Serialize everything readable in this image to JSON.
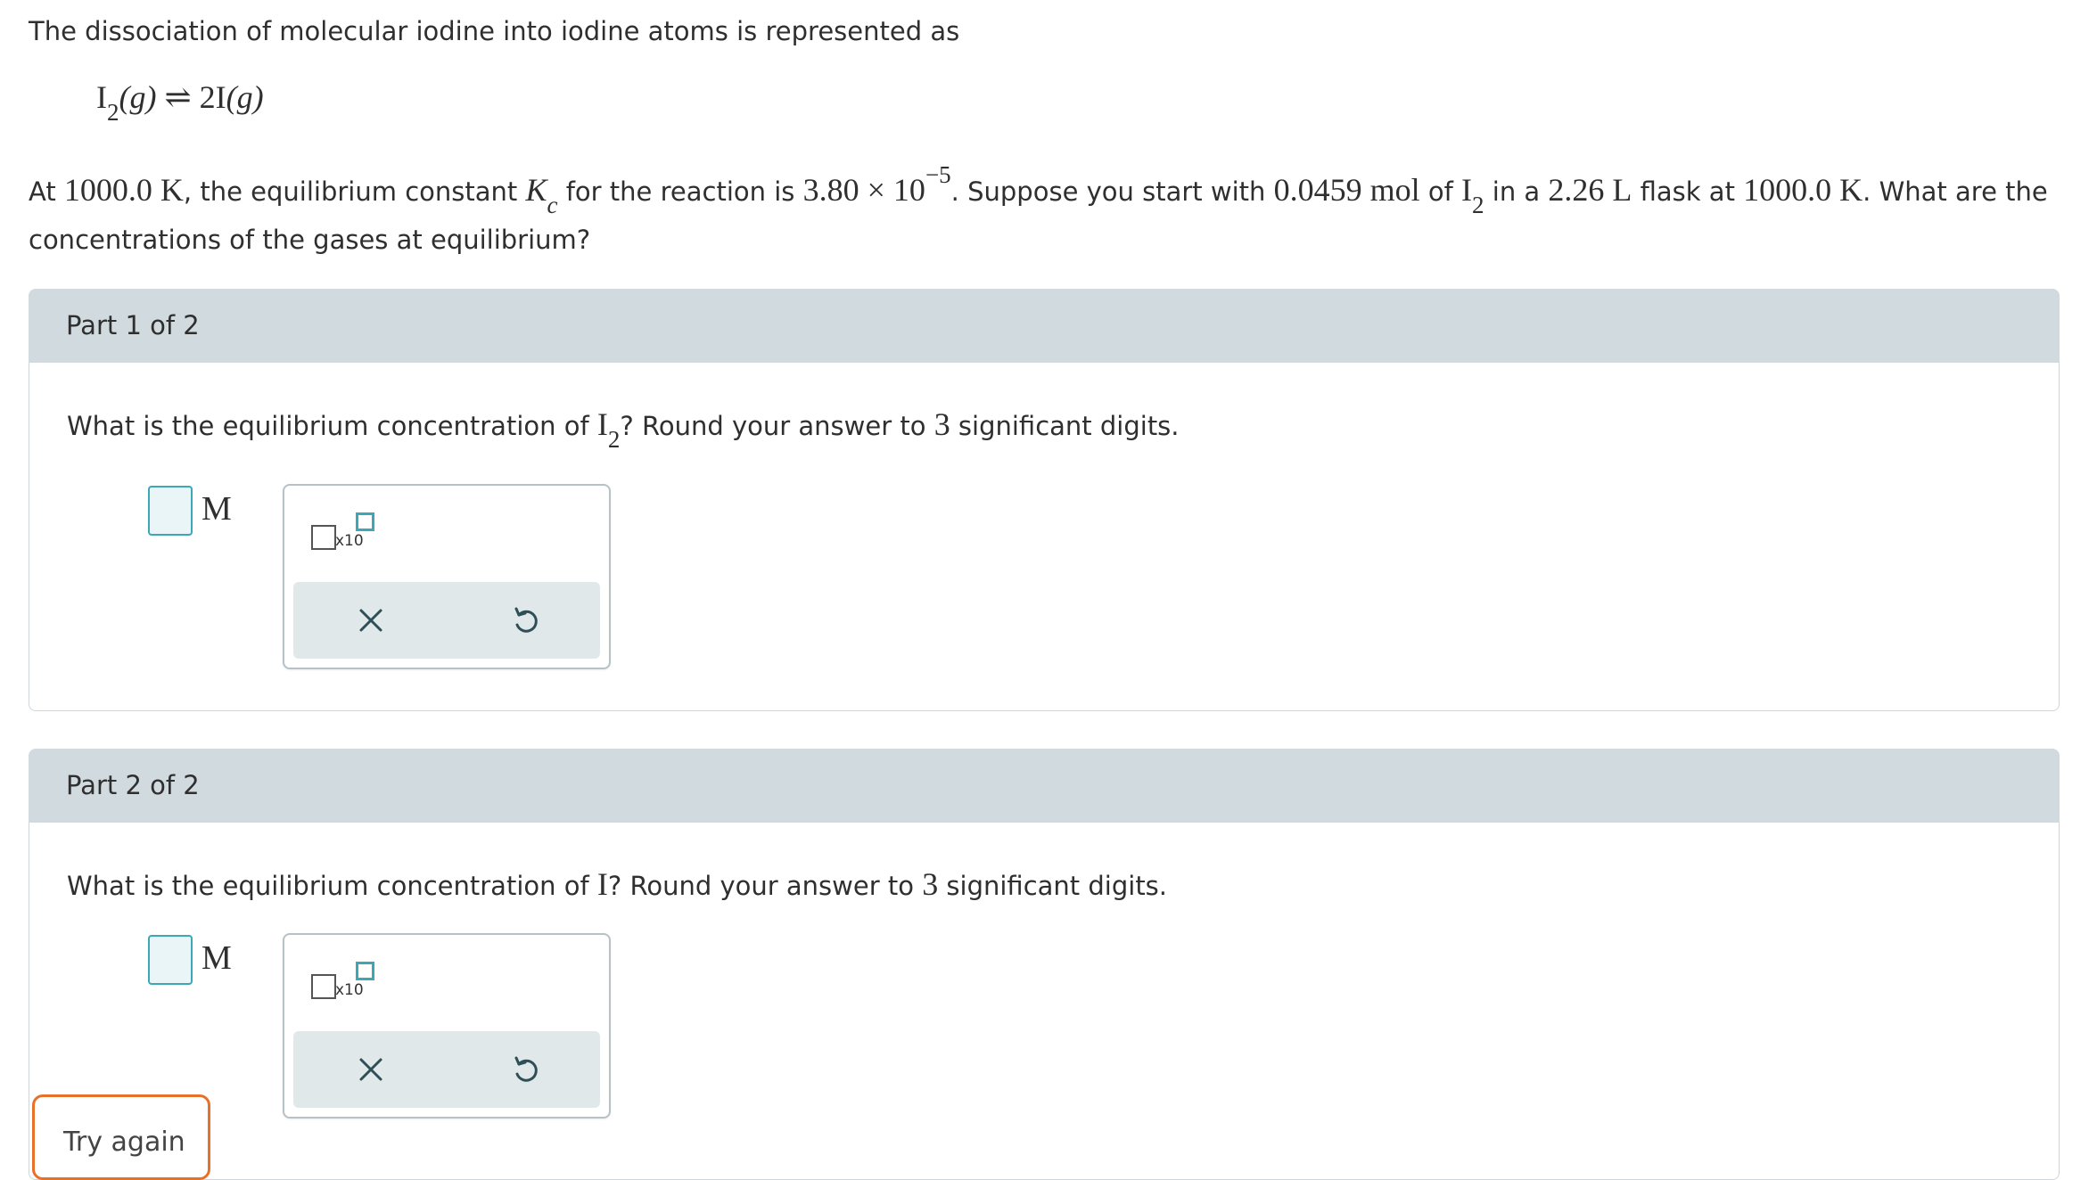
{
  "intro": "The dissociation of molecular iodine into iodine atoms is represented as",
  "reaction": {
    "reactant": "I",
    "reactant_sub": "2",
    "reactant_state": "(g)",
    "arrow": "⇌",
    "product_coef": "2",
    "product": "I",
    "product_state": "(g)"
  },
  "problem": {
    "p1": "At ",
    "temp1": "1000.0 K",
    "p2": ", the equilibrium constant ",
    "k": "K",
    "k_sub": "c",
    "p3": " for the reaction is ",
    "kval": "3.80 × 10",
    "kexp": "−5",
    "p4": ". Suppose you start with ",
    "mol": "0.0459 mol",
    "p5": " of ",
    "i": "I",
    "i_sub": "2",
    "p6": " in a ",
    "vol": "2.26 L",
    "p7": " flask at ",
    "temp2": "1000.0 K",
    "p8": ". What are the",
    "line2": "concentrations of the gases at equilibrium?"
  },
  "parts": [
    {
      "header": "Part 1 of 2",
      "q1": "What is the equilibrium concentration of ",
      "qsym": "I",
      "qsub": "2",
      "q2": "? Round your answer to ",
      "qnum": "3",
      "q3": " significant digits.",
      "unit": "M",
      "answer_value": "",
      "sci_label": "x10"
    },
    {
      "header": "Part 2 of 2",
      "q1": "What is the equilibrium concentration of ",
      "qsym": "I",
      "qsub": "",
      "q2": "? Round your answer to ",
      "qnum": "3",
      "q3": " significant digits.",
      "unit": "M",
      "answer_value": "",
      "sci_label": "x10"
    }
  ],
  "try_again": "Try again",
  "icons": {
    "clear": "close-icon",
    "undo": "undo-icon"
  },
  "colors": {
    "header_bg": "#d1dbdf",
    "accent": "#3aa8b7",
    "try_border": "#e8712a"
  }
}
